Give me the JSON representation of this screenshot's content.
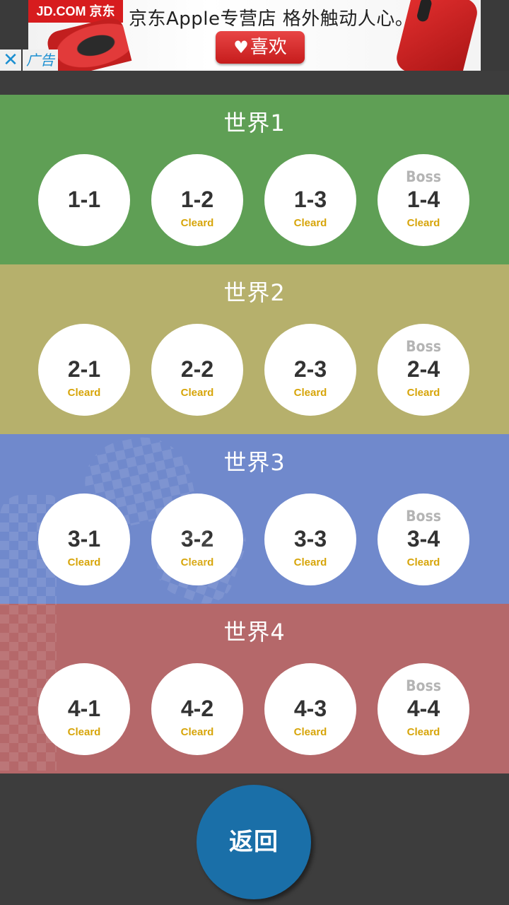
{
  "ad": {
    "logo_text": "JD.COM 京东",
    "headline": "京东Apple专营店  格外触动人心。",
    "like_button_label": "喜欢",
    "close_icon": "close-icon",
    "ad_label": "广告"
  },
  "worlds": [
    {
      "title": "世界1",
      "color": "#5f9f55",
      "stages": [
        {
          "id": "1-1",
          "boss": "",
          "status": ""
        },
        {
          "id": "1-2",
          "boss": "",
          "status": "Cleard"
        },
        {
          "id": "1-3",
          "boss": "",
          "status": "Cleard"
        },
        {
          "id": "1-4",
          "boss": "Boss",
          "status": "Cleard"
        }
      ]
    },
    {
      "title": "世界2",
      "color": "#b6b06c",
      "stages": [
        {
          "id": "2-1",
          "boss": "",
          "status": "Cleard"
        },
        {
          "id": "2-2",
          "boss": "",
          "status": "Cleard"
        },
        {
          "id": "2-3",
          "boss": "",
          "status": "Cleard"
        },
        {
          "id": "2-4",
          "boss": "Boss",
          "status": "Cleard"
        }
      ]
    },
    {
      "title": "世界3",
      "color": "#7089cc",
      "stages": [
        {
          "id": "3-1",
          "boss": "",
          "status": "Cleard"
        },
        {
          "id": "3-2",
          "boss": "",
          "status": "Cleard"
        },
        {
          "id": "3-3",
          "boss": "",
          "status": "Cleard"
        },
        {
          "id": "3-4",
          "boss": "Boss",
          "status": "Cleard"
        }
      ]
    },
    {
      "title": "世界4",
      "color": "#b5686a",
      "stages": [
        {
          "id": "4-1",
          "boss": "",
          "status": "Cleard"
        },
        {
          "id": "4-2",
          "boss": "",
          "status": "Cleard"
        },
        {
          "id": "4-3",
          "boss": "",
          "status": "Cleard"
        },
        {
          "id": "4-4",
          "boss": "Boss",
          "status": "Cleard"
        }
      ]
    }
  ],
  "back_button_label": "返回",
  "colors": {
    "status_text": "#d7a50a",
    "boss_text": "#b4b4b4",
    "back_button": "#1a6fa8",
    "background": "#3d3d3d"
  }
}
